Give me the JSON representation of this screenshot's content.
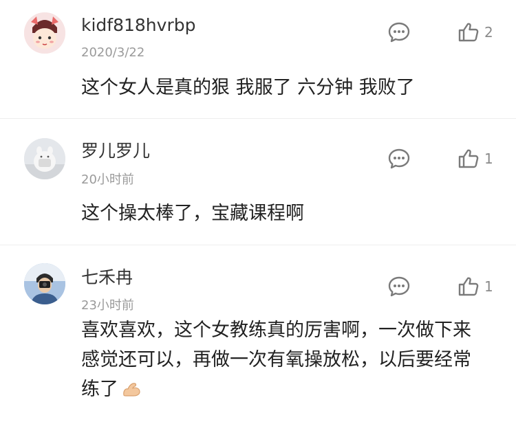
{
  "comments": [
    {
      "username": "kidf818hvrbp",
      "time": "2020/3/22",
      "text": "这个女人是真的狠 我服了 六分钟 我败了",
      "likes": "2",
      "avatar": "cartoon-girl-avatar"
    },
    {
      "username": "罗儿罗儿",
      "time": "20小时前",
      "text": "这个操太棒了，宝藏课程啊",
      "likes": "1",
      "avatar": "plush-toy-avatar"
    },
    {
      "username": "七禾冉",
      "time": "23小时前",
      "text": "喜欢喜欢，这个女教练真的厉害啊，一次做下来感觉还可以，再做一次有氧操放松，以后要经常练了",
      "likes": "1",
      "avatar": "person-with-camera-avatar",
      "emoji": "flexed-biceps-emoji"
    }
  ],
  "icons": {
    "reply": "chat-bubble-icon",
    "like": "thumbs-up-icon"
  },
  "colors": {
    "username": "#333333",
    "text": "#222222",
    "meta": "#9a9a9a",
    "icon": "#7a7a7a",
    "divider": "#eeeeee"
  }
}
